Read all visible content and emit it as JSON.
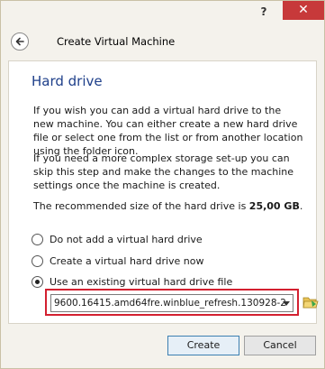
{
  "titlebar": {
    "help_label": "?",
    "close_label": "✕"
  },
  "header": {
    "title": "Create Virtual Machine"
  },
  "panel": {
    "section_title": "Hard drive",
    "paragraph1": "If you wish you can add a virtual hard drive to the new machine. You can either create a new hard drive file or select one from the list or from another location using the folder icon.",
    "paragraph2": "If you need a more complex storage set-up you can skip this step and make the changes to the machine settings once the machine is created.",
    "paragraph3_prefix": "The recommended size of the hard drive is ",
    "paragraph3_size": "25,00 GB",
    "paragraph3_suffix": "."
  },
  "options": [
    {
      "label": "Do not add a virtual hard drive",
      "checked": false
    },
    {
      "label": "Create a virtual hard drive now",
      "checked": false
    },
    {
      "label": "Use an existing virtual hard drive file",
      "checked": true
    }
  ],
  "file_select": {
    "value": "9600.16415.amd64fre.winblue_refresh.130928-2"
  },
  "buttons": {
    "create": "Create",
    "cancel": "Cancel"
  },
  "colors": {
    "accent_title": "#1e3f8a",
    "highlight_border": "#d32030",
    "close_bg": "#c7393a"
  },
  "icons": {
    "back": "back-arrow-icon",
    "folder": "folder-icon"
  }
}
